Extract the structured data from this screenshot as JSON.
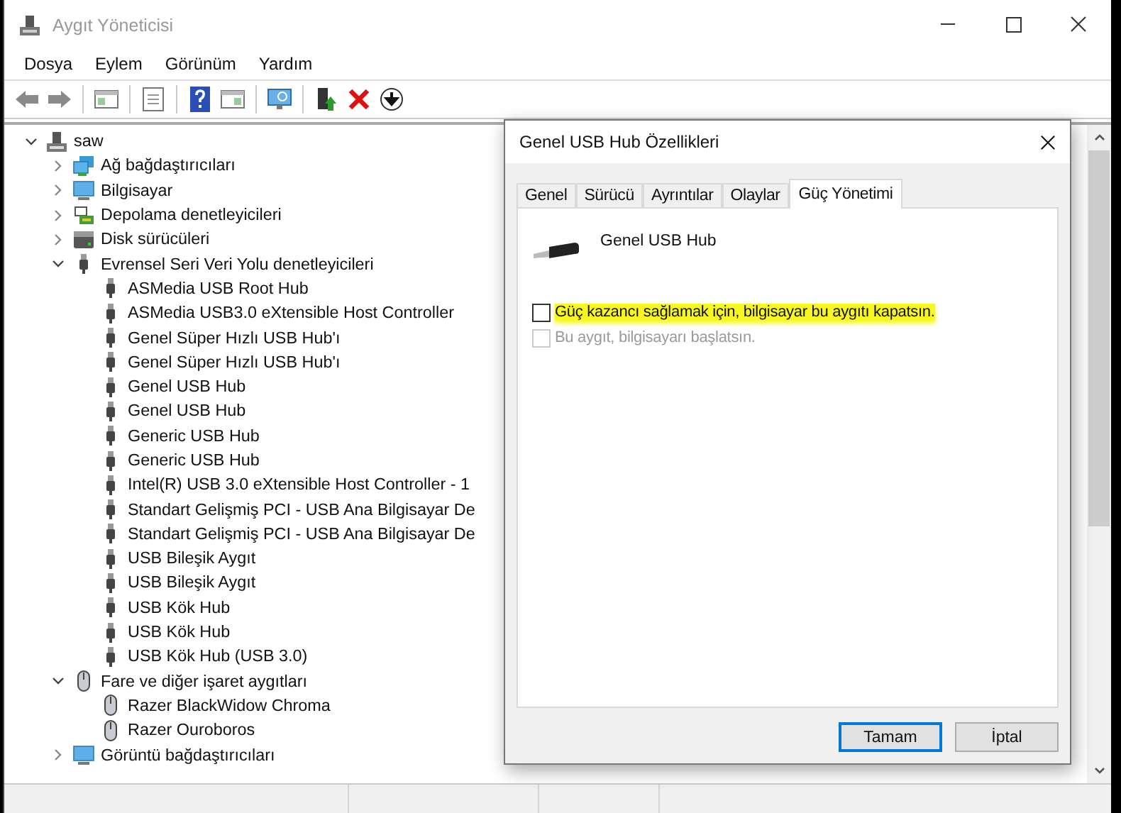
{
  "window": {
    "title": "Aygıt Yöneticisi"
  },
  "menu": [
    "Dosya",
    "Eylem",
    "Görünüm",
    "Yardım"
  ],
  "tree": {
    "label": "saw",
    "kind": "computer",
    "expanded": true,
    "children": [
      {
        "label": "Ağ bağdaştırıcıları",
        "kind": "network",
        "expanded": false
      },
      {
        "label": "Bilgisayar",
        "kind": "monitor",
        "expanded": false
      },
      {
        "label": "Depolama denetleyicileri",
        "kind": "storage",
        "expanded": false
      },
      {
        "label": "Disk sürücüleri",
        "kind": "disk",
        "expanded": false
      },
      {
        "label": "Evrensel Seri Veri Yolu denetleyicileri",
        "kind": "usb",
        "expanded": true,
        "children": [
          {
            "label": "ASMedia USB Root Hub",
            "kind": "usb"
          },
          {
            "label": "ASMedia USB3.0 eXtensible Host Controller",
            "kind": "usb"
          },
          {
            "label": "Genel Süper Hızlı USB Hub'ı",
            "kind": "usb"
          },
          {
            "label": "Genel Süper Hızlı USB Hub'ı",
            "kind": "usb"
          },
          {
            "label": "Genel USB Hub",
            "kind": "usb"
          },
          {
            "label": "Genel USB Hub",
            "kind": "usb"
          },
          {
            "label": "Generic USB Hub",
            "kind": "usb"
          },
          {
            "label": "Generic USB Hub",
            "kind": "usb"
          },
          {
            "label": "Intel(R) USB 3.0 eXtensible Host Controller - 1",
            "kind": "usb"
          },
          {
            "label": "Standart Gelişmiş PCI - USB Ana Bilgisayar De",
            "kind": "usb"
          },
          {
            "label": "Standart Gelişmiş PCI - USB Ana Bilgisayar De",
            "kind": "usb"
          },
          {
            "label": "USB Bileşik Aygıt",
            "kind": "usb"
          },
          {
            "label": "USB Bileşik Aygıt",
            "kind": "usb"
          },
          {
            "label": "USB Kök Hub",
            "kind": "usb"
          },
          {
            "label": "USB Kök Hub",
            "kind": "usb"
          },
          {
            "label": "USB Kök Hub (USB 3.0)",
            "kind": "usb"
          }
        ]
      },
      {
        "label": "Fare ve diğer işaret aygıtları",
        "kind": "mouse",
        "expanded": true,
        "children": [
          {
            "label": "Razer BlackWidow Chroma",
            "kind": "mouse"
          },
          {
            "label": "Razer Ouroboros",
            "kind": "mouse"
          }
        ]
      },
      {
        "label": "Görüntü bağdaştırıcıları",
        "kind": "monitor",
        "expanded": false
      }
    ]
  },
  "dialog": {
    "title": "Genel USB Hub Özellikleri",
    "tabs": [
      {
        "label": "Genel",
        "selected": false
      },
      {
        "label": "Sürücü",
        "selected": false
      },
      {
        "label": "Ayrıntılar",
        "selected": false
      },
      {
        "label": "Olaylar",
        "selected": false
      },
      {
        "label": "Güç Yönetimi",
        "selected": true
      }
    ],
    "device_name": "Genel USB Hub",
    "options": [
      {
        "label": "Güç kazancı sağlamak için, bilgisayar bu aygıtı kapatsın.",
        "checked": false,
        "disabled": false,
        "highlighted": true
      },
      {
        "label": "Bu aygıt, bilgisayarı başlatsın.",
        "checked": false,
        "disabled": true,
        "highlighted": false
      }
    ],
    "buttons": [
      {
        "label": "Tamam",
        "default": true
      },
      {
        "label": "İptal",
        "default": false
      }
    ]
  }
}
